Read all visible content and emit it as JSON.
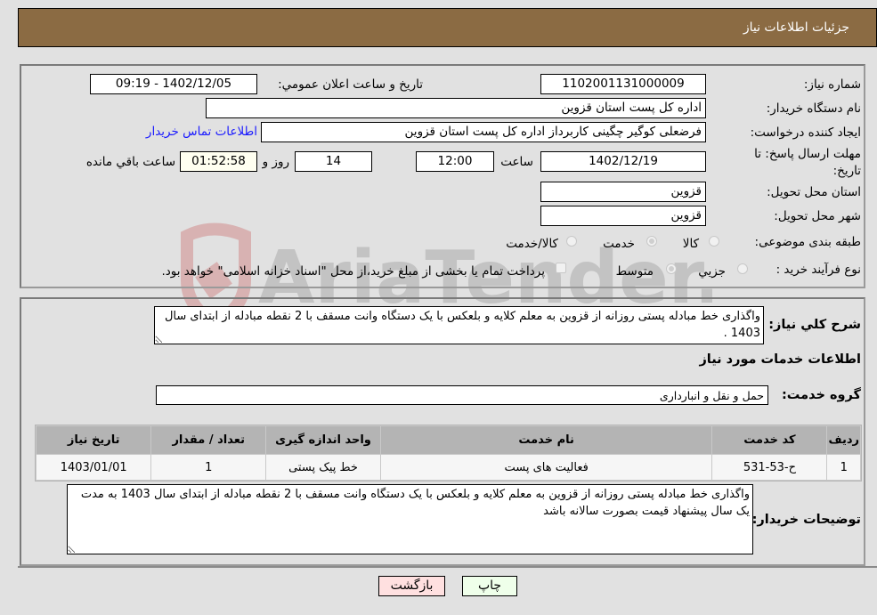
{
  "header": {
    "title": "جزئیات اطلاعات نیاز"
  },
  "fields": {
    "need_number": {
      "label": "شماره نیاز:",
      "value": "1102001131000009"
    },
    "announce_datetime": {
      "label": "تاریخ و ساعت اعلان عمومي:",
      "value": "1402/12/05 - 09:19"
    },
    "buyer_org": {
      "label": "نام دستگاه خريدار:",
      "value": "اداره کل پست استان قزوین"
    },
    "requester": {
      "label": "ایجاد کننده درخواست:",
      "value": "فرضعلی کوگیر چگینی کاربرداز اداره کل پست استان قزوین"
    },
    "buyer_contact_link": "اطلاعات تماس خريدار",
    "deadline": {
      "label": "مهلت ارسال پاسخ: تا تاریخ:",
      "date": "1402/12/19",
      "time_label": "ساعت",
      "time": "12:00",
      "days": "14",
      "days_label": "روز و",
      "remaining": "01:52:58",
      "remaining_label": "ساعت باقي مانده"
    },
    "delivery_province": {
      "label": "استان محل تحویل:",
      "value": "قزوین"
    },
    "delivery_city": {
      "label": "شهر محل تحویل:",
      "value": "قزوین"
    },
    "category": {
      "label": "طبقه بندی موضوعی:",
      "options": [
        {
          "label": "کالا",
          "selected": false
        },
        {
          "label": "خدمت",
          "selected": true
        },
        {
          "label": "کالا/خدمت",
          "selected": false
        }
      ]
    },
    "purchase_type": {
      "label": "نوع فرآیند خرید :",
      "options": [
        {
          "label": "جزيي",
          "selected": false
        },
        {
          "label": "متوسط",
          "selected": true
        }
      ],
      "treasury_checkbox": {
        "label": "پرداخت تمام يا بخشی از مبلغ خرید،از محل \"اسناد خزانه اسلامی\" خواهد بود.",
        "checked": false
      }
    }
  },
  "description": {
    "label": "شرح کلي نياز:",
    "value": "واگذاری خط مبادله پستی روزانه از قزوین به معلم کلایه و بلعکس با یک دستگاه وانت مسقف با 2 نقطه مبادله از ابتدای سال 1403 ."
  },
  "services": {
    "title": "اطلاعات خدمات مورد نياز",
    "group_label": "گروه خدمت:",
    "group_value": "حمل و نقل و انبارداری",
    "table": {
      "headers": [
        "رديف",
        "کد خدمت",
        "نام خدمت",
        "واحد اندازه گیری",
        "تعداد / مقدار",
        "تاريخ نياز"
      ],
      "rows": [
        [
          "1",
          "ح-53-531",
          "فعالیت های پست",
          "خط پیک پستی",
          "1",
          "1403/01/01"
        ]
      ]
    }
  },
  "buyer_notes": {
    "label": "توضیحات خریدار:",
    "value": "واگذاری خط مبادله پستی روزانه از قزوین به معلم کلایه و بلعکس با یک دستگاه وانت مسقف با 2 نقطه مبادله از ابتدای سال 1403 به مدت یک سال پیشنهاد قیمت بصورت سالانه باشد"
  },
  "buttons": {
    "print": "چاپ",
    "back": "بازگشت"
  },
  "watermark": "AriaTender.net",
  "colors": {
    "header_bg": "#8b6b43",
    "print_bg": "#efffea",
    "back_bg": "#ffe0e0",
    "link": "#1a1aff"
  }
}
